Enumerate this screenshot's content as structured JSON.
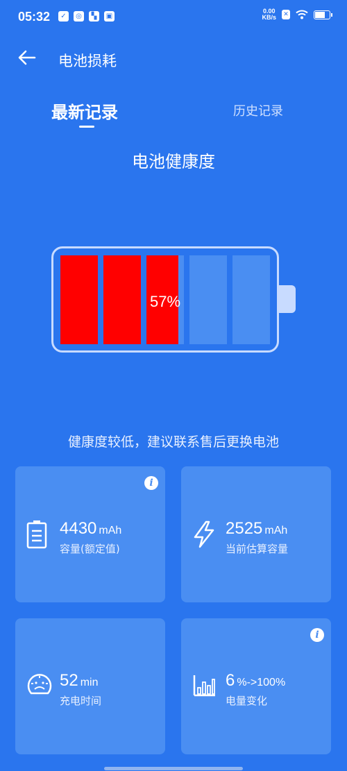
{
  "status_bar": {
    "time": "05:32",
    "net_speed_value": "0.00",
    "net_speed_unit": "KB/s",
    "battery_level": 0.8
  },
  "header": {
    "title": "电池损耗"
  },
  "tabs": [
    {
      "label": "最新记录",
      "active": true
    },
    {
      "label": "历史记录",
      "active": false
    }
  ],
  "section_title": "电池健康度",
  "battery_health": {
    "percent_label": "57%",
    "percent": 57,
    "cells_total": 5,
    "fill_color": "#ff0000",
    "empty_color": "#4a8ef2"
  },
  "health_message": "健康度较低，建议联系售后更换电池",
  "cards": [
    {
      "value": "4430",
      "unit": "mAh",
      "label": "容量(额定值)",
      "icon": "battery-outline-icon",
      "has_info": true
    },
    {
      "value": "2525",
      "unit": "mAh",
      "label": "当前估算容量",
      "icon": "lightning-icon",
      "has_info": false
    },
    {
      "value": "52",
      "unit": "min",
      "label": "充电时间",
      "icon": "speedometer-icon",
      "has_info": false
    },
    {
      "value": "6",
      "unit": "%->100%",
      "label": "电量变化",
      "icon": "bar-chart-icon",
      "has_info": true
    }
  ],
  "colors": {
    "background": "#2a75ee",
    "card": "#4a8ef2",
    "text": "#ffffff"
  }
}
